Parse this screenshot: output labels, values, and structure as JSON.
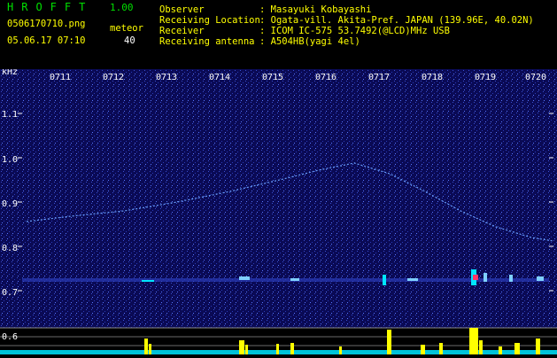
{
  "app": {
    "title": "HROFFT",
    "version": "1.00",
    "filename": "0506170710.png",
    "datetime": "05.06.17 07:10",
    "meteor_label": "meteor",
    "meteor_count": "40"
  },
  "info": {
    "rows": [
      {
        "label": "Observer",
        "value": ": Masayuki Kobayashi"
      },
      {
        "label": "Receiving Location",
        "value": ": Ogata-vill. Akita-Pref. JAPAN (139.96E, 40.02N)"
      },
      {
        "label": "Receiver",
        "value": ": ICOM IC-575 53.7492(@LCD)MHz USB"
      },
      {
        "label": "Receiving antenna",
        "value": ": A504HB(yagi 4el)"
      }
    ]
  },
  "spectrogram": {
    "unit_label": "kHz",
    "time_ticks": [
      "0711",
      "0712",
      "0713",
      "0714",
      "0715",
      "0716",
      "0717",
      "0718",
      "0719",
      "0720"
    ],
    "freq_ticks": [
      "1.1",
      "1.0",
      "0.9",
      "0.8",
      "0.7",
      "0.6"
    ],
    "colors": {
      "background": "#0a0a55",
      "signal": "#5a8cff",
      "level": "#00e5ff",
      "peak": "#ffff00",
      "meteor": "#ff3366"
    }
  }
}
